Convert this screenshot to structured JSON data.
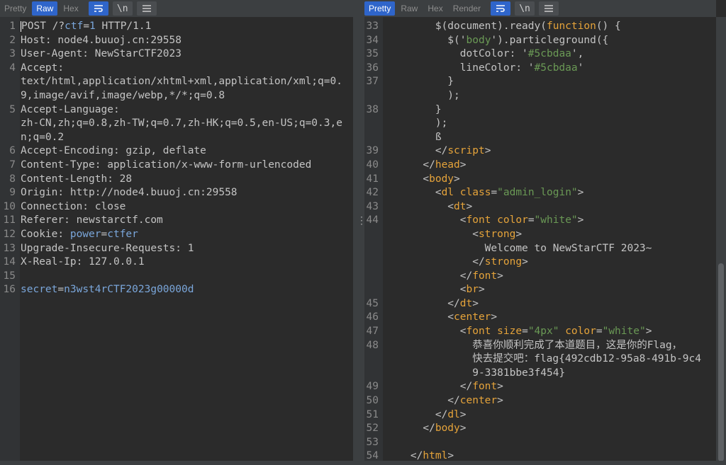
{
  "request": {
    "tabs": [
      "Pretty",
      "Raw",
      "Hex"
    ],
    "active_tab": "Raw",
    "lines": [
      {
        "n": "1",
        "segs": [
          [
            "POST /?",
            ""
          ],
          [
            "ctf",
            "blue"
          ],
          [
            "=",
            ""
          ],
          [
            "1",
            "blue"
          ],
          [
            " HTTP/1.1",
            ""
          ]
        ]
      },
      {
        "n": "2",
        "segs": [
          [
            "Host: node4.buuoj.cn:29558",
            ""
          ]
        ]
      },
      {
        "n": "3",
        "segs": [
          [
            "User-Agent: NewStarCTF2023",
            ""
          ]
        ]
      },
      {
        "n": "4",
        "segs": [
          [
            "Accept:",
            ""
          ]
        ]
      },
      {
        "n": "",
        "segs": [
          [
            "text/html,application/xhtml+xml,application/xml;q=0.",
            ""
          ]
        ]
      },
      {
        "n": "",
        "segs": [
          [
            "9,image/avif,image/webp,*/*;q=0.8",
            ""
          ]
        ]
      },
      {
        "n": "5",
        "segs": [
          [
            "Accept-Language:",
            ""
          ]
        ]
      },
      {
        "n": "",
        "segs": [
          [
            "zh-CN,zh;q=0.8,zh-TW;q=0.7,zh-HK;q=0.5,en-US;q=0.3,e",
            ""
          ]
        ]
      },
      {
        "n": "",
        "segs": [
          [
            "n;q=0.2",
            ""
          ]
        ]
      },
      {
        "n": "6",
        "segs": [
          [
            "Accept-Encoding: gzip, deflate",
            ""
          ]
        ]
      },
      {
        "n": "7",
        "segs": [
          [
            "Content-Type: application/x-www-form-urlencoded",
            ""
          ]
        ]
      },
      {
        "n": "8",
        "segs": [
          [
            "Content-Length: 28",
            ""
          ]
        ]
      },
      {
        "n": "9",
        "segs": [
          [
            "Origin: http://node4.buuoj.cn:29558",
            ""
          ]
        ]
      },
      {
        "n": "10",
        "segs": [
          [
            "Connection: close",
            ""
          ]
        ]
      },
      {
        "n": "11",
        "segs": [
          [
            "Referer: newstarctf.com",
            ""
          ]
        ]
      },
      {
        "n": "12",
        "segs": [
          [
            "Cookie: ",
            ""
          ],
          [
            "power",
            "blue"
          ],
          [
            "=",
            ""
          ],
          [
            "ctfer",
            "blue"
          ]
        ]
      },
      {
        "n": "13",
        "segs": [
          [
            "Upgrade-Insecure-Requests: 1",
            ""
          ]
        ]
      },
      {
        "n": "14",
        "segs": [
          [
            "X-Real-Ip: 127.0.0.1",
            ""
          ]
        ]
      },
      {
        "n": "15",
        "segs": [
          [
            "",
            ""
          ]
        ]
      },
      {
        "n": "16",
        "segs": [
          [
            "secret",
            "blue"
          ],
          [
            "=",
            ""
          ],
          [
            "n3wst4rCTF2023g00000d",
            "blue"
          ]
        ]
      }
    ]
  },
  "response": {
    "tabs": [
      "Pretty",
      "Raw",
      "Hex",
      "Render"
    ],
    "active_tab": "Pretty",
    "lines": [
      {
        "n": "33",
        "segs": [
          [
            "        $(document).ready(",
            ""
          ],
          [
            "function",
            "tag"
          ],
          [
            "() {",
            ""
          ]
        ]
      },
      {
        "n": "34",
        "segs": [
          [
            "          $('",
            ""
          ],
          [
            "body",
            "str"
          ],
          [
            "').particleground({",
            ""
          ]
        ]
      },
      {
        "n": "35",
        "segs": [
          [
            "            dotColor: '",
            ""
          ],
          [
            "#5cbdaa",
            "str"
          ],
          [
            "',",
            ""
          ]
        ]
      },
      {
        "n": "36",
        "segs": [
          [
            "            lineColor: '",
            ""
          ],
          [
            "#5cbdaa",
            "str"
          ],
          [
            "'",
            ""
          ]
        ]
      },
      {
        "n": "37",
        "segs": [
          [
            "          }",
            ""
          ]
        ]
      },
      {
        "n": "",
        "segs": [
          [
            "          );",
            ""
          ]
        ]
      },
      {
        "n": "38",
        "segs": [
          [
            "        }",
            ""
          ]
        ]
      },
      {
        "n": "",
        "segs": [
          [
            "        );",
            ""
          ]
        ]
      },
      {
        "n": "",
        "segs": [
          [
            "        ß",
            ""
          ]
        ]
      },
      {
        "n": "39",
        "segs": [
          [
            "        </",
            ""
          ],
          [
            "script",
            "tag"
          ],
          [
            ">",
            ""
          ]
        ]
      },
      {
        "n": "40",
        "segs": [
          [
            "      </",
            ""
          ],
          [
            "head",
            "tag"
          ],
          [
            ">",
            ""
          ]
        ]
      },
      {
        "n": "41",
        "segs": [
          [
            "      <",
            ""
          ],
          [
            "body",
            "tag"
          ],
          [
            ">",
            ""
          ]
        ]
      },
      {
        "n": "42",
        "segs": [
          [
            "        <",
            ""
          ],
          [
            "dl ",
            "tag"
          ],
          [
            "class",
            "tag"
          ],
          [
            "=",
            ""
          ],
          [
            "\"admin_login\"",
            "str"
          ],
          [
            ">",
            ""
          ]
        ]
      },
      {
        "n": "43",
        "segs": [
          [
            "          <",
            ""
          ],
          [
            "dt",
            "tag"
          ],
          [
            ">",
            ""
          ]
        ]
      },
      {
        "n": "44",
        "segs": [
          [
            "            <",
            ""
          ],
          [
            "font ",
            "tag"
          ],
          [
            "color",
            "tag"
          ],
          [
            "=",
            ""
          ],
          [
            "\"white\"",
            "str"
          ],
          [
            ">",
            ""
          ]
        ]
      },
      {
        "n": "",
        "segs": [
          [
            "              <",
            ""
          ],
          [
            "strong",
            "tag"
          ],
          [
            ">",
            ""
          ]
        ]
      },
      {
        "n": "",
        "segs": [
          [
            "                Welcome to NewStarCTF 2023~",
            ""
          ]
        ]
      },
      {
        "n": "",
        "segs": [
          [
            "              </",
            ""
          ],
          [
            "strong",
            "tag"
          ],
          [
            ">",
            ""
          ]
        ]
      },
      {
        "n": "",
        "segs": [
          [
            "            </",
            ""
          ],
          [
            "font",
            "tag"
          ],
          [
            ">",
            ""
          ]
        ]
      },
      {
        "n": "",
        "segs": [
          [
            "            <",
            ""
          ],
          [
            "br",
            "tag"
          ],
          [
            ">",
            ""
          ]
        ]
      },
      {
        "n": "45",
        "segs": [
          [
            "          </",
            ""
          ],
          [
            "dt",
            "tag"
          ],
          [
            ">",
            ""
          ]
        ]
      },
      {
        "n": "46",
        "segs": [
          [
            "          <",
            ""
          ],
          [
            "center",
            "tag"
          ],
          [
            ">",
            ""
          ]
        ]
      },
      {
        "n": "47",
        "segs": [
          [
            "            <",
            ""
          ],
          [
            "font ",
            "tag"
          ],
          [
            "size",
            "tag"
          ],
          [
            "=",
            ""
          ],
          [
            "\"4px\"",
            "str"
          ],
          [
            " ",
            ""
          ],
          [
            "color",
            "tag"
          ],
          [
            "=",
            ""
          ],
          [
            "\"white\"",
            "str"
          ],
          [
            ">",
            ""
          ]
        ]
      },
      {
        "n": "48",
        "segs": [
          [
            "              恭喜你顺利完成了本道题目，这是你的Flag，",
            ""
          ]
        ]
      },
      {
        "n": "",
        "segs": [
          [
            "              快去提交吧：flag{492cdb12-95a8-491b-9c4",
            ""
          ]
        ]
      },
      {
        "n": "",
        "segs": [
          [
            "              9-3381bbe3f454}",
            ""
          ]
        ]
      },
      {
        "n": "49",
        "segs": [
          [
            "            </",
            ""
          ],
          [
            "font",
            "tag"
          ],
          [
            ">",
            ""
          ]
        ]
      },
      {
        "n": "50",
        "segs": [
          [
            "          </",
            ""
          ],
          [
            "center",
            "tag"
          ],
          [
            ">",
            ""
          ]
        ]
      },
      {
        "n": "51",
        "segs": [
          [
            "        </",
            ""
          ],
          [
            "dl",
            "tag"
          ],
          [
            ">",
            ""
          ]
        ]
      },
      {
        "n": "52",
        "segs": [
          [
            "      </",
            ""
          ],
          [
            "body",
            "tag"
          ],
          [
            ">",
            ""
          ]
        ]
      },
      {
        "n": "53",
        "segs": [
          [
            "",
            ""
          ]
        ]
      },
      {
        "n": "54",
        "segs": [
          [
            "    </",
            ""
          ],
          [
            "html",
            "tag"
          ],
          [
            ">",
            ""
          ]
        ]
      }
    ]
  },
  "icons": [
    "wrap-lines-icon",
    "newline-icon",
    "menu-icon"
  ],
  "colors": {
    "accent": "#2f65ca",
    "tag": "#e5a33a",
    "string": "#6a9955",
    "param": "#7aa6da"
  }
}
